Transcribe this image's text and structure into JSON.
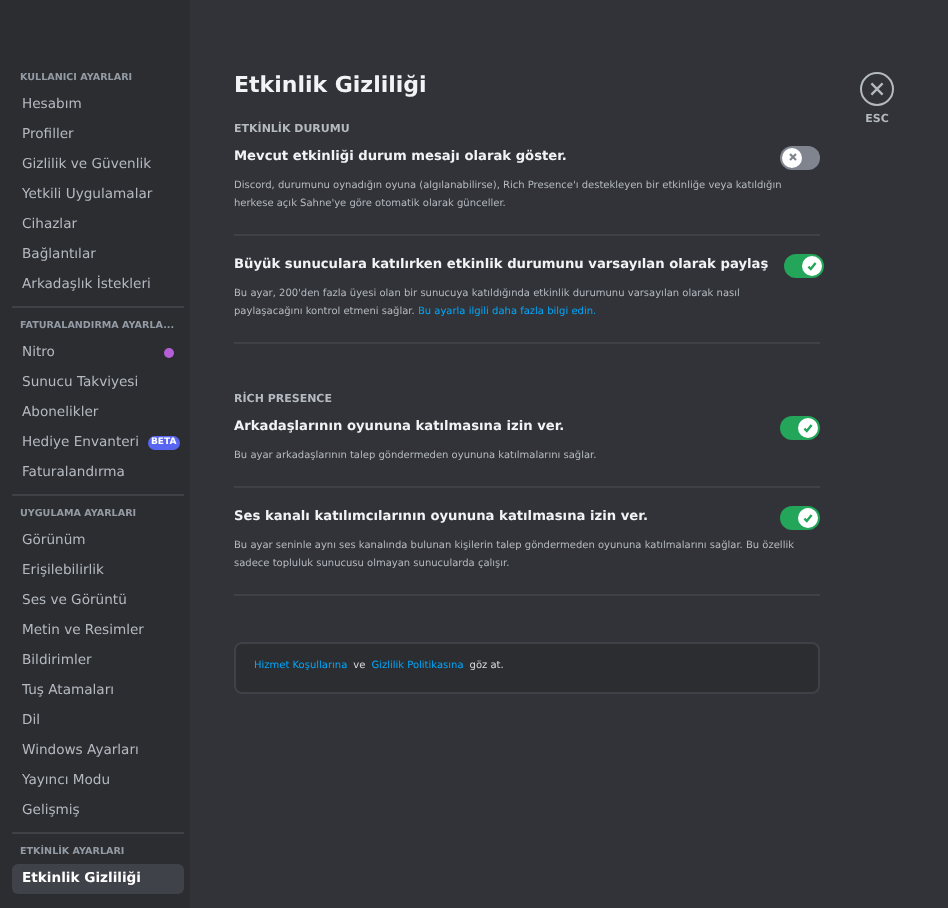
{
  "sidebar": {
    "sections": [
      {
        "header": "KULLANICI AYARLARI",
        "items": [
          {
            "label": "Hesabım",
            "selected": false
          },
          {
            "label": "Profiller",
            "selected": false
          },
          {
            "label": "Gizlilik ve Güvenlik",
            "selected": false
          },
          {
            "label": "Yetkili Uygulamalar",
            "selected": false
          },
          {
            "label": "Cihazlar",
            "selected": false
          },
          {
            "label": "Bağlantılar",
            "selected": false
          },
          {
            "label": "Arkadaşlık İstekleri",
            "selected": false
          }
        ]
      },
      {
        "header": "FATURALANDIRMA AYARLA...",
        "items": [
          {
            "label": "Nitro",
            "selected": false,
            "dot": true
          },
          {
            "label": "Sunucu Takviyesi",
            "selected": false
          },
          {
            "label": "Abonelikler",
            "selected": false
          },
          {
            "label": "Hediye Envanteri",
            "selected": false,
            "badge": "BETA"
          },
          {
            "label": "Faturalandırma",
            "selected": false
          }
        ]
      },
      {
        "header": "UYGULAMA AYARLARI",
        "items": [
          {
            "label": "Görünüm",
            "selected": false
          },
          {
            "label": "Erişilebilirlik",
            "selected": false
          },
          {
            "label": "Ses ve Görüntü",
            "selected": false
          },
          {
            "label": "Metin ve Resimler",
            "selected": false
          },
          {
            "label": "Bildirimler",
            "selected": false
          },
          {
            "label": "Tuş Atamaları",
            "selected": false
          },
          {
            "label": "Dil",
            "selected": false
          },
          {
            "label": "Windows Ayarları",
            "selected": false
          },
          {
            "label": "Yayıncı Modu",
            "selected": false
          },
          {
            "label": "Gelişmiş",
            "selected": false
          }
        ]
      },
      {
        "header": "ETKİNLİK AYARLARI",
        "items": [
          {
            "label": "Etkinlik Gizliliği",
            "selected": true
          }
        ]
      }
    ]
  },
  "title": "Etkinlik Gizliliği",
  "groups": [
    {
      "header": "ETKİNLİK DURUMU",
      "settings": [
        {
          "title": "Mevcut etkinliği durum mesajı olarak göster.",
          "on": false,
          "description": "Discord, durumunu oynadığın oyuna (algılanabilirse), Rich Presence'ı destekleyen bir etkinliğe veya katıldığın herkese açık Sahne'ye göre otomatik olarak günceller."
        },
        {
          "title": "Büyük sunuculara katılırken etkinlik durumunu varsayılan olarak paylaş",
          "on": true,
          "description": "Bu ayar, 200'den fazla üyesi olan bir sunucuya katıldığında etkinlik durumunu varsayılan olarak nasıl paylaşacağını kontrol etmeni sağlar.",
          "link": "Bu ayarla ilgili daha fazla bilgi edin."
        }
      ]
    },
    {
      "header": "RİCH PRESENCE",
      "settings": [
        {
          "title": "Arkadaşlarının oyununa katılmasına izin ver.",
          "on": true,
          "description": "Bu ayar arkadaşlarının talep göndermeden oyununa katılmalarını sağlar."
        },
        {
          "title": "Ses kanalı katılımcılarının oyununa katılmasına izin ver.",
          "on": true,
          "description": "Bu ayar seninle aynı ses kanalında bulunan kişilerin talep göndermeden oyununa katılmalarını sağlar. Bu özellik sadece topluluk sunucusu olmayan sunucularda çalışır."
        }
      ]
    }
  ],
  "footer": [
    {
      "kind": "link",
      "text": "Hizmet Koşullarına"
    },
    {
      "kind": "text",
      "text": "ve"
    },
    {
      "kind": "link",
      "text": "Gizlilik Politikasına"
    },
    {
      "kind": "text",
      "text": "göz at."
    }
  ],
  "close": {
    "label": "ESC"
  }
}
